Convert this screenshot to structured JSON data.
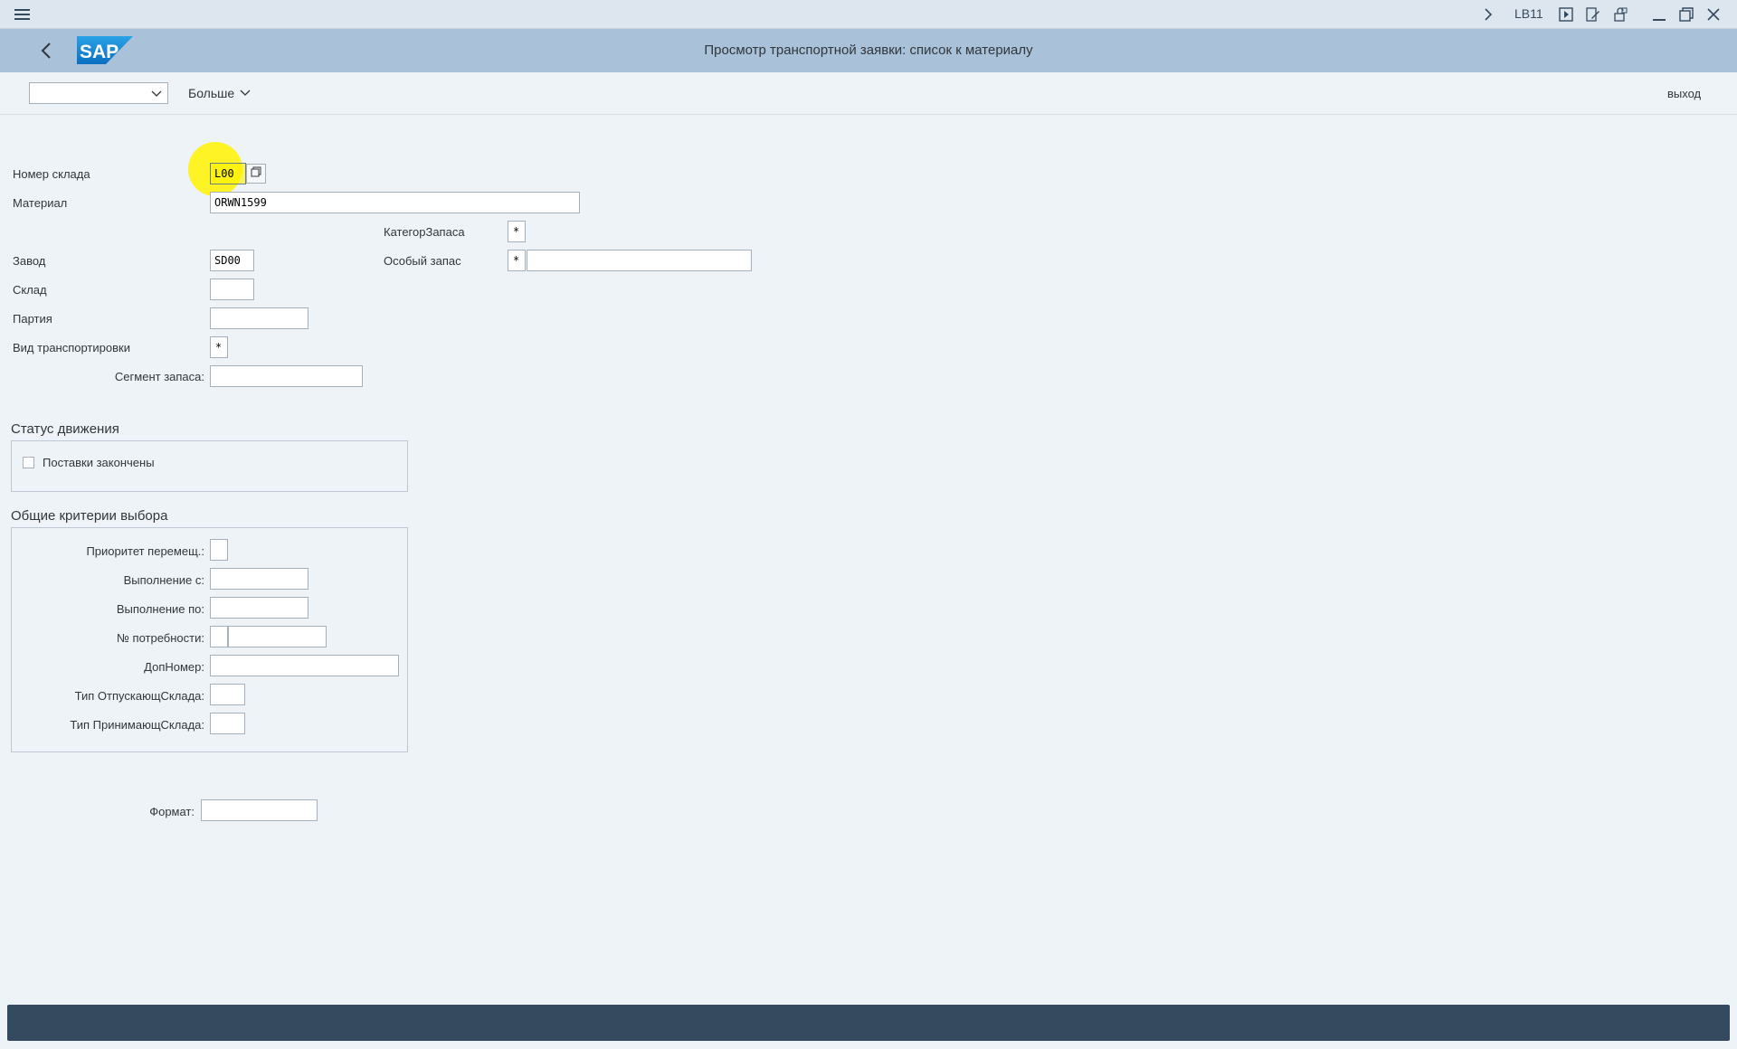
{
  "system_bar": {
    "transaction_code": "LB11",
    "icons": [
      "menu-icon",
      "chevron-right-icon",
      "run-icon",
      "edit-icon",
      "lock-icon",
      "minimize-icon",
      "restore-icon",
      "close-icon"
    ]
  },
  "title_bar": {
    "title": "Просмотр транспортной заявки: список к материалу",
    "logo_text": "SAP",
    "logo_color": "#1f8dd6"
  },
  "toolbar": {
    "command_select_value": "",
    "more_label": "Больше",
    "exit_label": "выход"
  },
  "form": {
    "warehouse": {
      "label": "Номер склада",
      "value": "L00"
    },
    "material": {
      "label": "Материал",
      "value": "ORWN1599"
    },
    "stock_category": {
      "label": "КатегорЗапаса",
      "value": "*"
    },
    "plant": {
      "label": "Завод",
      "value": "SD00"
    },
    "special_stock": {
      "label": "Особый запас",
      "value1": "*",
      "value2": ""
    },
    "storage_location": {
      "label": "Склад",
      "value": ""
    },
    "batch": {
      "label": "Партия",
      "value": ""
    },
    "transport_type": {
      "label": "Вид транспортировки",
      "value": "*"
    },
    "stock_segment": {
      "label": "Сегмент запаса:",
      "value": ""
    }
  },
  "movement_status": {
    "title": "Статус движения",
    "deliveries_completed": {
      "label": "Поставки закончены",
      "checked": false
    }
  },
  "general_criteria": {
    "title": "Общие критерии выбора",
    "priority": {
      "label": "Приоритет перемещ.:",
      "value": ""
    },
    "exec_from": {
      "label": "Выполнение с:",
      "value": ""
    },
    "exec_to": {
      "label": "Выполнение по:",
      "value": ""
    },
    "requirement_no": {
      "label": "№ потребности:",
      "value1": "",
      "value2": ""
    },
    "add_number": {
      "label": "ДопНомер:",
      "value": ""
    },
    "source_type": {
      "label": "Тип ОтпускающСклада:",
      "value": ""
    },
    "dest_type": {
      "label": "Тип ПринимающСклада:",
      "value": ""
    }
  },
  "format": {
    "label": "Формат:",
    "value": ""
  },
  "status_bar": {
    "text": ""
  }
}
